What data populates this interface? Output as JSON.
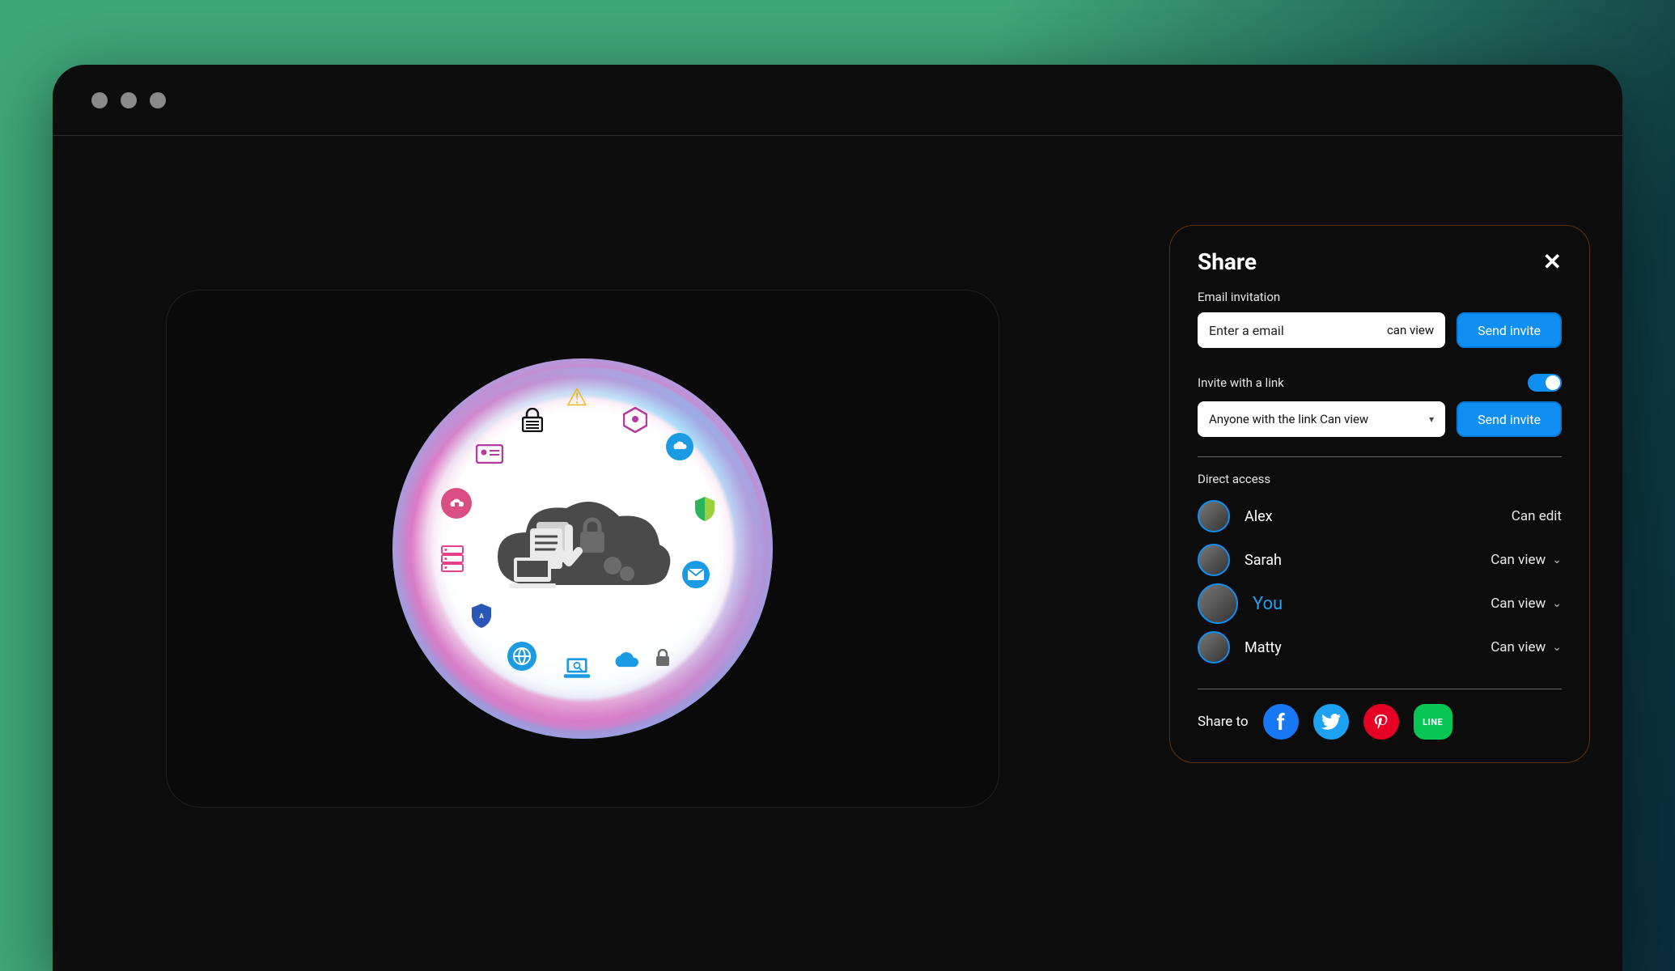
{
  "share": {
    "title": "Share",
    "close_label": "✕",
    "email_section_label": "Email invitation",
    "email_placeholder": "Enter a email",
    "email_perm": "can view",
    "send_invite_label": "Send invite",
    "link_section_label": "Invite with a link",
    "link_toggle_on": true,
    "link_send_label": "Send invite",
    "link_select_text": "Anyone with the link Can view",
    "direct_access_label": "Direct access",
    "users": [
      {
        "name": "Alex",
        "perm": "Can edit",
        "dropdown": false,
        "you": false
      },
      {
        "name": "Sarah",
        "perm": "Can view",
        "dropdown": true,
        "you": false
      },
      {
        "name": "You",
        "perm": "Can view",
        "dropdown": true,
        "you": true
      },
      {
        "name": "Matty",
        "perm": "Can view",
        "dropdown": true,
        "you": false
      }
    ],
    "share_to_label": "Share to",
    "socials": [
      "facebook",
      "twitter",
      "pinterest",
      "line"
    ]
  },
  "icons": {
    "facebook": "f",
    "pinterest": "p",
    "line": "LINE"
  }
}
